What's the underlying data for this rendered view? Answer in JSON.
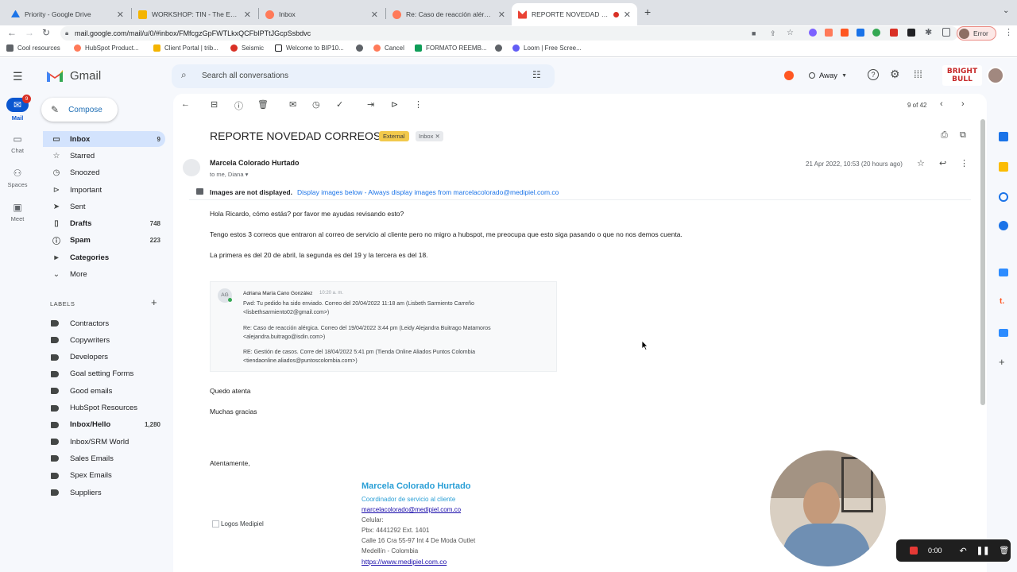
{
  "browser": {
    "tabs": [
      {
        "title": "Priority - Google Drive",
        "color": "#1a73e8"
      },
      {
        "title": "WORKSHOP: TIN - The Essent",
        "color": "#f4b400"
      },
      {
        "title": "Inbox",
        "color": "#ff7a59"
      },
      {
        "title": "Re: Caso de reacción alérgica",
        "color": "#ff7a59"
      },
      {
        "title": "REPORTE NOVEDAD CORR",
        "color": "#ea4335"
      }
    ],
    "new_tab": "+",
    "url": "mail.google.com/mail/u/0/#inbox/FMfcgzGpFWTLkxQCFbIPTtJGcpSsbdvc",
    "profile_status": "Error",
    "bookmarks": [
      {
        "label": "Cool resources",
        "color": "#5f6368"
      },
      {
        "label": "HubSpot Product...",
        "color": "#ff7a59"
      },
      {
        "label": "Client Portal | trib...",
        "color": "#f4b400"
      },
      {
        "label": "Seismic",
        "color": "#d93025"
      },
      {
        "label": "Welcome to BIP10...",
        "color": "#202124"
      },
      {
        "label": "",
        "color": "#5f6368"
      },
      {
        "label": "Cancel",
        "color": "#ff7a59"
      },
      {
        "label": "FORMATO REEMB...",
        "color": "#0f9d58"
      },
      {
        "label": "",
        "color": "#5f6368"
      },
      {
        "label": "Loom | Free Scree...",
        "color": "#625df5"
      }
    ]
  },
  "gmail": {
    "brand": "Gmail",
    "search_placeholder": "Search all conversations",
    "status": "Away",
    "compose": "Compose",
    "rail": [
      {
        "label": "Mail",
        "badge": "9"
      },
      {
        "label": "Chat"
      },
      {
        "label": "Spaces"
      },
      {
        "label": "Meet"
      }
    ],
    "nav": [
      {
        "label": "Inbox",
        "count": "9",
        "icon": "inbox-icon",
        "glyph": "▭"
      },
      {
        "label": "Starred",
        "count": "",
        "icon": "star-icon",
        "glyph": "☆"
      },
      {
        "label": "Snoozed",
        "count": "",
        "icon": "clock-icon",
        "glyph": "◷"
      },
      {
        "label": "Important",
        "count": "",
        "icon": "important-icon",
        "glyph": "⊳"
      },
      {
        "label": "Sent",
        "count": "",
        "icon": "send-icon",
        "glyph": "➤"
      },
      {
        "label": "Drafts",
        "count": "748",
        "icon": "draft-icon",
        "glyph": "▯"
      },
      {
        "label": "Spam",
        "count": "223",
        "icon": "spam-icon",
        "glyph": "ⓘ"
      },
      {
        "label": "Categories",
        "count": "",
        "icon": "label-icon",
        "glyph": "▸"
      },
      {
        "label": "More",
        "count": "",
        "icon": "chevron-down-icon",
        "glyph": "⌄"
      }
    ],
    "labels_heading": "LABELS",
    "labels": [
      {
        "label": "Contractors",
        "count": "",
        "bold": false
      },
      {
        "label": "Copywriters",
        "count": "",
        "bold": false
      },
      {
        "label": "Developers",
        "count": "",
        "bold": false
      },
      {
        "label": "Goal setting Forms",
        "count": "",
        "bold": false
      },
      {
        "label": "Good emails",
        "count": "",
        "bold": false
      },
      {
        "label": "HubSpot Resources",
        "count": "",
        "bold": false
      },
      {
        "label": "Inbox/Hello",
        "count": "1,280",
        "bold": true
      },
      {
        "label": "Inbox/SRM World",
        "count": "",
        "bold": false
      },
      {
        "label": "Sales Emails",
        "count": "",
        "bold": false
      },
      {
        "label": "Spex Emails",
        "count": "",
        "bold": false
      },
      {
        "label": "Suppliers",
        "count": "",
        "bold": false
      }
    ],
    "pager": "9 of 42",
    "brand_logo": "BRIGHT BULL"
  },
  "email": {
    "subject": "REPORTE NOVEDAD CORREOS",
    "tag_external": "External",
    "tag_inbox": "Inbox",
    "sender": "Marcela Colorado Hurtado",
    "recipients": "to me, Diana",
    "date": "21 Apr 2022, 10:53 (20 hours ago)",
    "images_notice": "Images are not displayed.",
    "images_link": "Display images below - Always display images from marcelacolorado@medipiel.com.co",
    "body": [
      "Hola Ricardo, cómo estás? por favor me ayudas revisando esto?",
      "Tengo estos 3 correos que entraron al correo de servicio al cliente pero no migro a hubspot, me preocupa que esto siga pasando o que no nos demos cuenta.",
      "La primera es del 20 de abril, la segunda es del 19 y la tercera es del 18."
    ],
    "quoted": {
      "avatar": "AG",
      "name": "Adriana María Cano González",
      "time": "10:20 a. m.",
      "items": [
        [
          "Fwd: Tu pedido ha sido enviado. Correo del 20/04/2022 11:18 am (Lisbeth Sarmiento Carreño",
          "<lisbethsarmiento02@gmail.com>)"
        ],
        [
          "Re: Caso de reacción alérgica. Correo del 19/04/2022 3:44 pm (Leidy Alejandra Buitrago Matamoros",
          "<alejandra.buitrago@isdin.com>)"
        ],
        [
          "RE: Gestión de casos. Corre del 18/04/2022 5:41 pm (Tienda Online Aliados Puntos Colombia",
          "<tiendaonline.aliados@puntoscolombia.com>)"
        ]
      ]
    },
    "closing1": "Quedo atenta",
    "closing2": "Muchas gracias",
    "signoff": "Atentamente,",
    "logo_alt": "Logos Medipiel",
    "signature": {
      "name": "Marcela Colorado Hurtado",
      "role": "Coordinador de servicio al cliente",
      "email": "marcelacolorado@medipiel.com.co",
      "mobile": "Celular:",
      "pbx": "Pbx: 4441292 Ext. 1401",
      "address": "Calle 16 Cra 55-97 Int 4 De Moda Outlet",
      "city": "Medellín - Colombia",
      "web": "https://www.medipiel.com.co"
    }
  },
  "recorder": {
    "time": "0:00"
  }
}
